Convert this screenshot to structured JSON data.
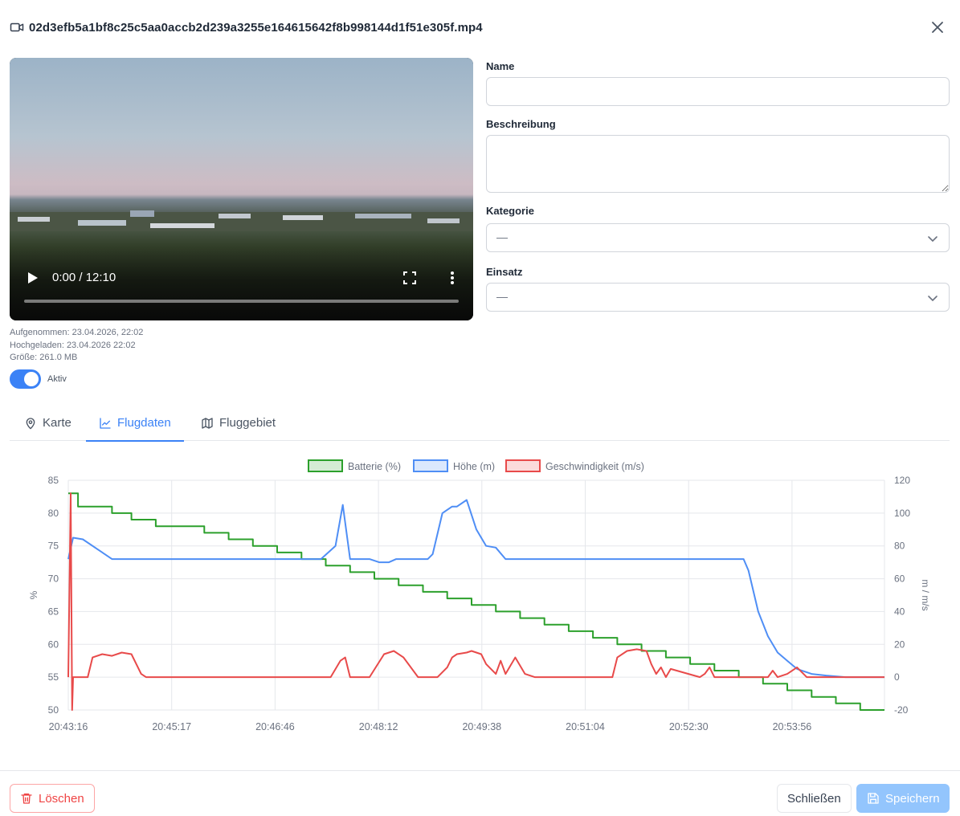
{
  "header": {
    "title": "02d3efb5a1bf8c25c5aa0accb2d239a3255e164615642f8b998144d1f51e305f.mp4"
  },
  "video": {
    "time": "0:00 / 12:10"
  },
  "meta": {
    "recorded": "Aufgenommen: 23.04.2026, 22:02",
    "uploaded": "Hochgeladen: 23.04.2026 22:02",
    "size": "Größe: 261.0 MB"
  },
  "toggle": {
    "label": "Aktiv",
    "on": true
  },
  "form": {
    "name_label": "Name",
    "name_value": "",
    "description_label": "Beschreibung",
    "description_value": "",
    "category_label": "Kategorie",
    "category_value": "—",
    "mission_label": "Einsatz",
    "mission_value": "—"
  },
  "tabs": [
    {
      "label": "Karte",
      "active": false
    },
    {
      "label": "Flugdaten",
      "active": true
    },
    {
      "label": "Fluggebiet",
      "active": false
    }
  ],
  "colors": {
    "accent": "#3b82f6",
    "battery": "#2ca02c",
    "height": "#4f8ef5",
    "speed": "#e84a4a",
    "danger": "#ef4444"
  },
  "chart_data": {
    "type": "line",
    "x_ticks": [
      "20:43:16",
      "20:45:17",
      "20:46:46",
      "20:48:12",
      "20:49:38",
      "20:51:04",
      "20:52:30",
      "20:53:56"
    ],
    "y_left_label": "%",
    "y_left_range": [
      50,
      85
    ],
    "y_left_ticks": [
      50,
      55,
      60,
      65,
      70,
      75,
      80,
      85
    ],
    "y_right_label": "m / m/s",
    "y_right_range": [
      -20,
      120
    ],
    "y_right_ticks": [
      -20,
      0,
      20,
      40,
      60,
      80,
      100,
      120
    ],
    "grid": true,
    "legend_position": "top",
    "series": [
      {
        "name": "Batterie (%)",
        "axis": "left",
        "x": [
          0,
          0.2,
          0.4,
          0.9,
          1.3,
          1.8,
          2.3,
          2.8,
          3.3,
          3.8,
          4.3,
          4.8,
          5.3,
          5.8,
          6.3,
          6.8,
          7.3,
          7.8,
          8.3,
          8.8,
          9.3,
          9.8,
          10.3,
          10.8,
          11.3,
          11.8,
          12.3,
          12.8,
          13.3,
          13.8,
          14.3,
          14.8,
          15.3,
          15.8,
          16.3,
          16.8
        ],
        "values": [
          83,
          81,
          81,
          80,
          79,
          78,
          78,
          77,
          76,
          75,
          74,
          73,
          72,
          71,
          70,
          69,
          68,
          67,
          66,
          65,
          64,
          63,
          62,
          61,
          60,
          59,
          58,
          57,
          56,
          55,
          54,
          53,
          52,
          51,
          50,
          50
        ]
      },
      {
        "name": "Höhe (m)",
        "axis": "right",
        "x": [
          0,
          0.1,
          0.3,
          0.6,
          0.9,
          1.5,
          3.0,
          4.5,
          5.0,
          5.2,
          5.5,
          5.65,
          5.8,
          6.2,
          6.4,
          6.6,
          6.75,
          7.4,
          7.5,
          7.7,
          7.9,
          8.0,
          8.2,
          8.4,
          8.6,
          8.8,
          9.0,
          9.4,
          10.5,
          12.5,
          13.9,
          14.0,
          14.2,
          14.4,
          14.6,
          14.8,
          15.0,
          15.3,
          15.6,
          16.0,
          16.8
        ],
        "values": [
          72,
          85,
          84,
          78,
          72,
          72,
          72,
          72,
          72,
          72,
          80,
          105,
          72,
          72,
          70,
          70,
          72,
          72,
          75,
          100,
          104,
          104,
          108,
          90,
          80,
          79,
          72,
          72,
          72,
          72,
          72,
          65,
          40,
          25,
          15,
          10,
          5,
          2,
          1,
          0,
          0
        ]
      },
      {
        "name": "Geschwindigkeit (m/s)",
        "axis": "right",
        "x": [
          0,
          0.05,
          0.08,
          0.1,
          0.4,
          0.5,
          0.7,
          0.9,
          1.1,
          1.3,
          1.5,
          1.6,
          3.5,
          5.4,
          5.6,
          5.7,
          5.8,
          6.0,
          6.2,
          6.5,
          6.7,
          6.9,
          7.2,
          7.4,
          7.6,
          7.8,
          7.9,
          8.0,
          8.2,
          8.3,
          8.5,
          8.6,
          8.8,
          8.9,
          9.0,
          9.2,
          9.4,
          9.6,
          10.5,
          11.2,
          11.3,
          11.5,
          11.7,
          11.9,
          12.0,
          12.1,
          12.2,
          12.3,
          12.4,
          13.0,
          13.1,
          13.2,
          13.3,
          13.5,
          14.0,
          14.4,
          14.5,
          14.6,
          14.8,
          15.0,
          15.2,
          16.8
        ],
        "values": [
          0,
          112,
          -20,
          0,
          0,
          12,
          14,
          13,
          15,
          14,
          2,
          0,
          0,
          0,
          10,
          12,
          0,
          0,
          0,
          14,
          16,
          12,
          0,
          0,
          0,
          6,
          12,
          14,
          15,
          16,
          14,
          8,
          2,
          10,
          2,
          12,
          2,
          0,
          0,
          0,
          12,
          16,
          17,
          16,
          8,
          2,
          6,
          0,
          5,
          0,
          2,
          6,
          0,
          0,
          0,
          0,
          4,
          0,
          2,
          6,
          0,
          0
        ]
      }
    ]
  },
  "footer": {
    "delete_label": "Löschen",
    "close_label": "Schließen",
    "save_label": "Speichern"
  }
}
